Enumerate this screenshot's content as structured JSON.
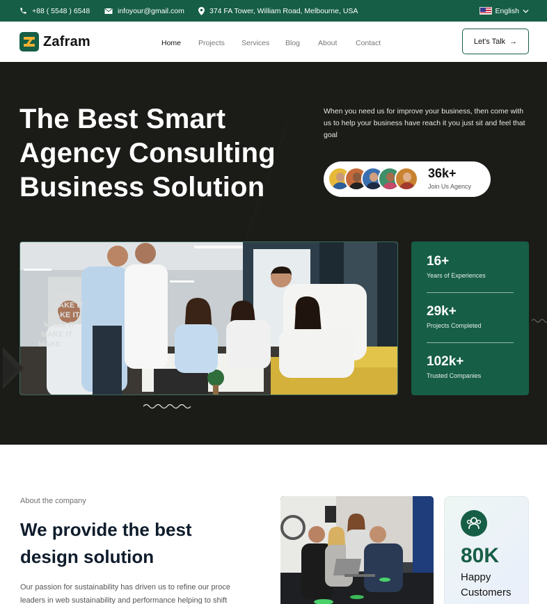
{
  "topbar": {
    "phone": "+88 ( 5548 ) 6548",
    "email": "infoyour@gmail.com",
    "address": "374 FA Tower, William Road, Melbourne, USA",
    "language": "English"
  },
  "brand": {
    "name": "Zafram"
  },
  "nav": {
    "items": [
      {
        "label": "Home",
        "active": true
      },
      {
        "label": "Projects",
        "active": false
      },
      {
        "label": "Services",
        "active": false
      },
      {
        "label": "Blog",
        "active": false
      },
      {
        "label": "About",
        "active": false
      },
      {
        "label": "Contact",
        "active": false
      }
    ],
    "cta_label": "Let's Talk",
    "cta_arrow": "→"
  },
  "hero": {
    "title": "The Best Smart Agency Consulting Business Solution",
    "description": "When you need us for improve your business, then come with us to help your business have reach it you just sit and feel that goal",
    "join": {
      "count": "36k+",
      "label": "Join Us Agency"
    },
    "poster_words": [
      "MAKE",
      "MAKE IT",
      "MAKE IT",
      "MAKE IT",
      "MAKE IT",
      "MAKE"
    ]
  },
  "stats": [
    {
      "value": "16+",
      "label": "Years of Experiences"
    },
    {
      "value": "29k+",
      "label": "Projects Completed"
    },
    {
      "value": "102k+",
      "label": "Trusted Companies"
    }
  ],
  "about": {
    "kicker": "About the company",
    "title": "We provide the best design solution",
    "body": "Our passion for sustainability has driven us to refine our proce leaders in web sustainability and performance helping to shift",
    "kpi": {
      "value": "80K",
      "label": "Happy Customers"
    }
  },
  "colors": {
    "brand_green": "#165e45",
    "hero_dark": "#1b1b18",
    "accent_yellow": "#f2b233"
  },
  "icons": [
    "phone-icon",
    "mail-icon",
    "location-pin-icon",
    "us-flag-icon",
    "chevron-down-icon",
    "arrow-right-icon",
    "users-icon"
  ]
}
